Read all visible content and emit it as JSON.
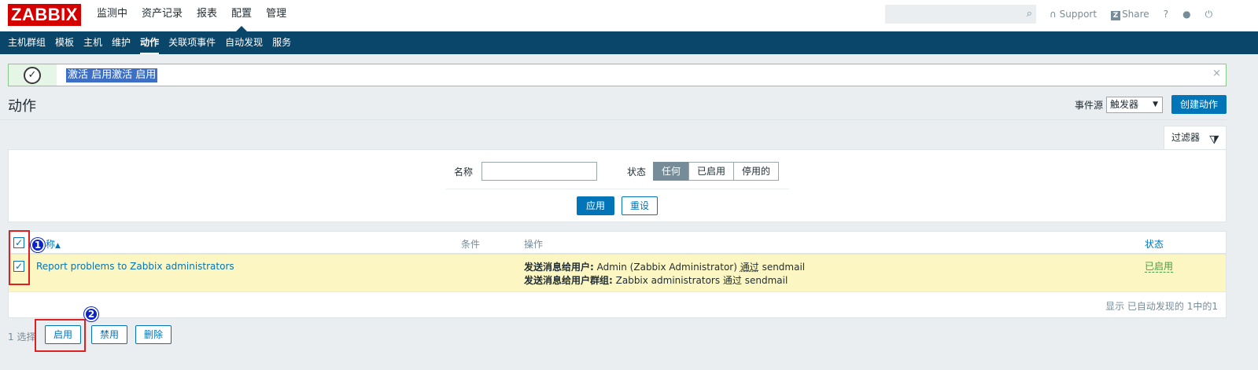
{
  "topbar": {
    "logo": "ZABBIX",
    "menu": [
      "监测中",
      "资产记录",
      "报表",
      "配置",
      "管理"
    ],
    "active_menu": "配置",
    "search_placeholder": "",
    "support_label": "Support",
    "share_label": "Share",
    "share_icon_letter": "Z",
    "help_label": "?"
  },
  "subnav": {
    "items": [
      "主机群组",
      "模板",
      "主机",
      "维护",
      "动作",
      "关联项事件",
      "自动发现",
      "服务"
    ],
    "active": "动作"
  },
  "message": {
    "text": "激活 启用激活 启用",
    "close": "×"
  },
  "header": {
    "title": "动作",
    "event_source_label": "事件源",
    "event_source_value": "触发器",
    "create_button": "创建动作"
  },
  "filter": {
    "tab_label": "过滤器",
    "name_label": "名称",
    "name_value": "",
    "status_label": "状态",
    "status_options": [
      "任何",
      "已启用",
      "停用的"
    ],
    "status_selected": "任何",
    "apply": "应用",
    "reset": "重设"
  },
  "table": {
    "columns": {
      "name": "名称",
      "sort_indicator": "▲",
      "conditions": "条件",
      "operations": "操作",
      "status": "状态"
    },
    "rows": [
      {
        "name": "Report problems to Zabbix administrators",
        "conditions": "",
        "op1_label": "发送消息给用户:",
        "op1_value": " Admin (Zabbix Administrator) ",
        "op1_via": "通过",
        "op1_media": " sendmail",
        "op2_label": "发送消息给用户群组:",
        "op2_value": " Zabbix administrators 通过 sendmail",
        "status": "已启用",
        "checked": true
      }
    ],
    "footer": "显示 已自动发现的 1中的1"
  },
  "actions": {
    "selected_count": "1 选择",
    "enable": "启用",
    "disable": "禁用",
    "delete": "删除"
  },
  "annotations": {
    "badge1": "1",
    "badge2": "2",
    "highlight_color": "#e02020",
    "badge_color": "#0a22c8"
  },
  "colors": {
    "header_bg": "#0a466a",
    "accent": "#0275b8",
    "logo_red": "#d40000",
    "row_highlight": "#fcf7c2",
    "enabled_green": "#429e47"
  }
}
